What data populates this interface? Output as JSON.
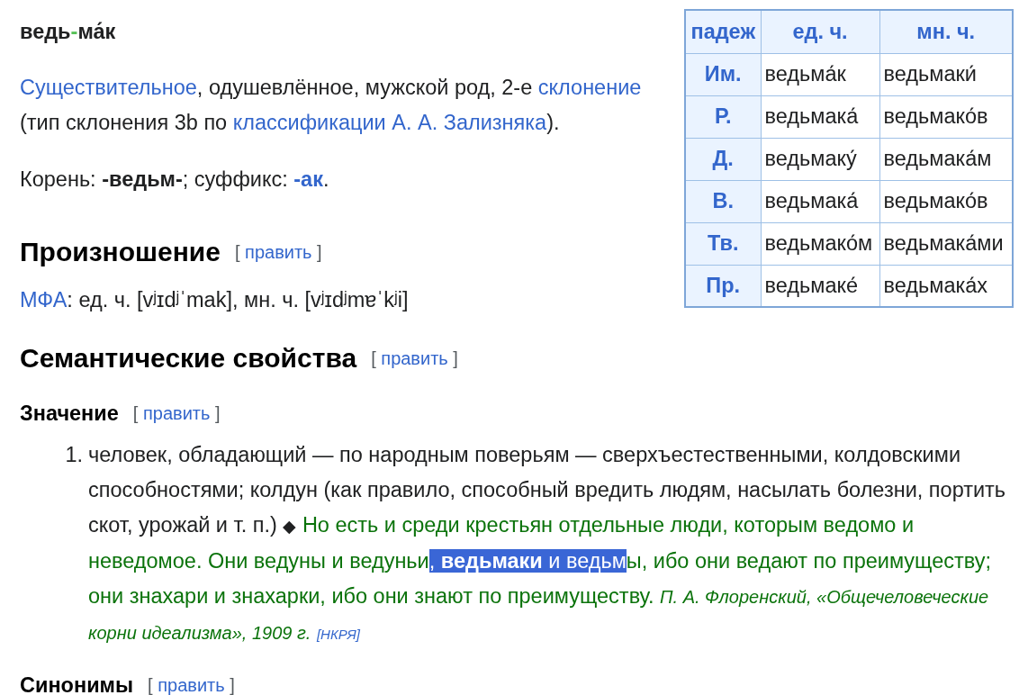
{
  "headword": {
    "syllables": [
      "ведь",
      "ма́к"
    ],
    "separator": "-"
  },
  "declension": {
    "columns": [
      "падеж",
      "ед. ч.",
      "мн. ч."
    ],
    "rows": [
      {
        "case": "Им.",
        "singular": "ведьма́к",
        "plural": "ведьмаки́"
      },
      {
        "case": "Р.",
        "singular": "ведьмака́",
        "plural": "ведьмако́в"
      },
      {
        "case": "Д.",
        "singular": "ведьмаку́",
        "plural": "ведьмака́м"
      },
      {
        "case": "В.",
        "singular": "ведьмака́",
        "plural": "ведьмако́в"
      },
      {
        "case": "Тв.",
        "singular": "ведьмако́м",
        "plural": "ведьмака́ми"
      },
      {
        "case": "Пр.",
        "singular": "ведьмаке́",
        "plural": "ведьмака́х"
      }
    ]
  },
  "morphology": [
    {
      "text": "Существительное",
      "link": true
    },
    {
      "text": ", одушевлённое, мужской род, 2-е ",
      "link": false
    },
    {
      "text": "склонение",
      "link": true
    },
    {
      "text": " (тип склонения 3b по ",
      "link": false
    },
    {
      "text": "классификации А. А. Зализняка",
      "link": true
    },
    {
      "text": ").",
      "link": false
    }
  ],
  "structure": [
    {
      "text": "Корень: ",
      "bold": false,
      "link": false
    },
    {
      "text": "-ведьм-",
      "bold": true,
      "link": false
    },
    {
      "text": "; суффикс: ",
      "bold": false,
      "link": false
    },
    {
      "text": "-ак",
      "bold": true,
      "link": true
    },
    {
      "text": ".",
      "bold": false,
      "link": false
    }
  ],
  "sections": [
    {
      "kind": "major",
      "title": "Произношение",
      "edit": {
        "open": "[",
        "label": "править",
        "close": "]"
      },
      "content": {
        "kind": "pronunciation",
        "segments": [
          {
            "text": "МФА",
            "link": true
          },
          {
            "text": ": ед. ч. [vʲɪdʲˈmak], мн. ч. [vʲɪdʲmɐˈkʲi]",
            "link": false
          }
        ]
      }
    },
    {
      "kind": "major",
      "title": "Семантические свойства",
      "edit": {
        "open": "[",
        "label": "править",
        "close": "]"
      }
    },
    {
      "kind": "minor",
      "title": "Значение",
      "edit": {
        "open": "[",
        "label": "править",
        "close": "]"
      },
      "content": {
        "kind": "definitions",
        "items": [
          {
            "number": "1.",
            "definition": "человек, обладающий — по народным поверьям — сверхъестественными, колдовскими способностями; колдун (как правило, способный вредить людям, насылать болезни, портить скот, урожай и т. п.)",
            "marker": "◆",
            "example": [
              {
                "text": "Но есть и среди крестьян отдельные люди, которым ведомо и неведомое. Они ведуны и ведуньи",
                "bold": false,
                "selected": false
              },
              {
                "text": ", ",
                "bold": false,
                "selected": true
              },
              {
                "text": "ведьмаки",
                "bold": true,
                "selected": true
              },
              {
                "text": " и ведьм",
                "bold": false,
                "selected": true
              },
              {
                "text": "ы, ибо они ведают по преимуществу; они знахари и знахарки, ибо они знают по преимуществу.",
                "bold": false,
                "selected": false
              }
            ],
            "source": "П. А. Флоренский, «Общечеловеческие корни идеализма», 1909 г.",
            "source_link": "[НКРЯ]"
          }
        ]
      }
    },
    {
      "kind": "minor",
      "title": "Синонимы",
      "edit": {
        "open": "[",
        "label": "править",
        "close": "]"
      }
    }
  ]
}
